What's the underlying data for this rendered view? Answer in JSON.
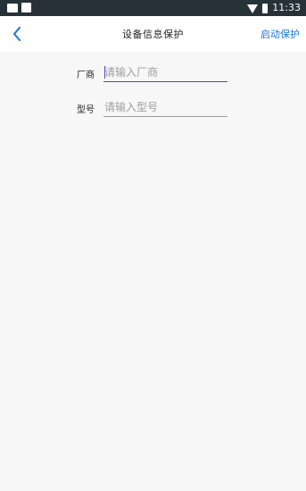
{
  "status_bar": {
    "time": "11:33",
    "icons": [
      "notification-icon",
      "notification-icon",
      "wifi-icon",
      "battery-icon"
    ]
  },
  "nav": {
    "back_icon": "chevron-left-icon",
    "title": "设备信息保护",
    "action_label": "启动保护"
  },
  "form": {
    "fields": [
      {
        "label": "厂商",
        "placeholder": "请输入厂商",
        "value": "",
        "focused": true
      },
      {
        "label": "型号",
        "placeholder": "请输入型号",
        "value": "",
        "focused": false
      }
    ]
  },
  "colors": {
    "accent": "#1976d2",
    "status_bar": "#263238",
    "focus_underline": "#3f51b5",
    "background": "#f7f7f7"
  }
}
